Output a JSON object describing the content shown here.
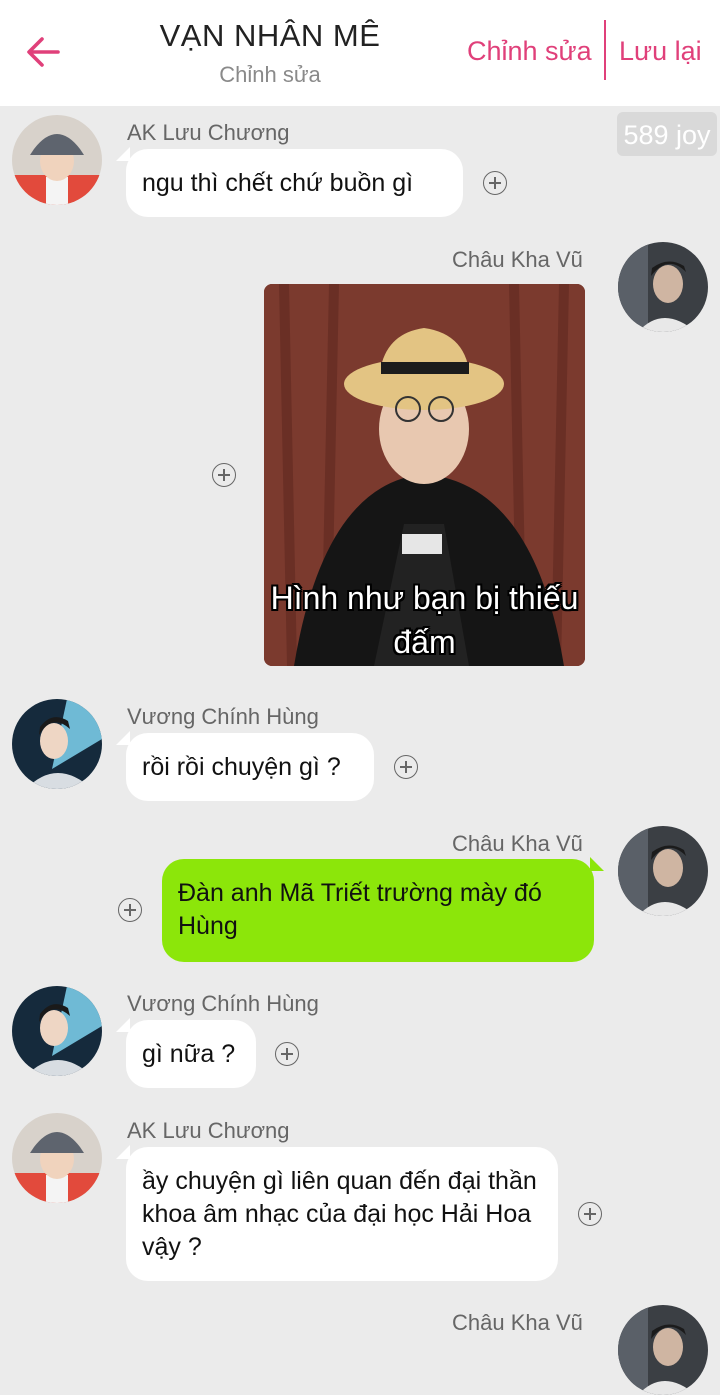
{
  "header": {
    "title": "VẠN NHÂN MÊ",
    "subtitle": "Chỉnh sửa",
    "edit_label": "Chỉnh sửa",
    "save_label": "Lưu lại",
    "back_icon": "arrow-left-icon",
    "accent_color": "#e0407a"
  },
  "joy_badge": "589 joy",
  "messages": [
    {
      "sender": "AK Lưu Chương",
      "direction": "incoming",
      "type": "text",
      "text": "ngu thì chết chứ buồn gì"
    },
    {
      "sender": "Châu Kha Vũ",
      "direction": "outgoing",
      "type": "sticker",
      "caption": "Hình như bạn bị thiếu đấm"
    },
    {
      "sender": "Vương Chính Hùng",
      "direction": "incoming",
      "type": "text",
      "text": "rồi rồi chuyện gì ?"
    },
    {
      "sender": "Châu Kha Vũ",
      "direction": "outgoing",
      "type": "text",
      "text": "Đàn anh Mã Triết trường mày đó Hùng"
    },
    {
      "sender": "Vương Chính Hùng",
      "direction": "incoming",
      "type": "text",
      "text": "gì nữa ?"
    },
    {
      "sender": "AK Lưu Chương",
      "direction": "incoming",
      "type": "text",
      "text": "ầy chuyện gì liên quan đến đại thần khoa âm nhạc của đại học Hải Hoa vậy ?"
    },
    {
      "sender": "Châu Kha Vũ",
      "direction": "outgoing",
      "type": "text",
      "text": ""
    }
  ],
  "colors": {
    "outgoing_bubble": "#8ce60a",
    "incoming_bubble": "#ffffff",
    "background": "#ebebeb"
  }
}
